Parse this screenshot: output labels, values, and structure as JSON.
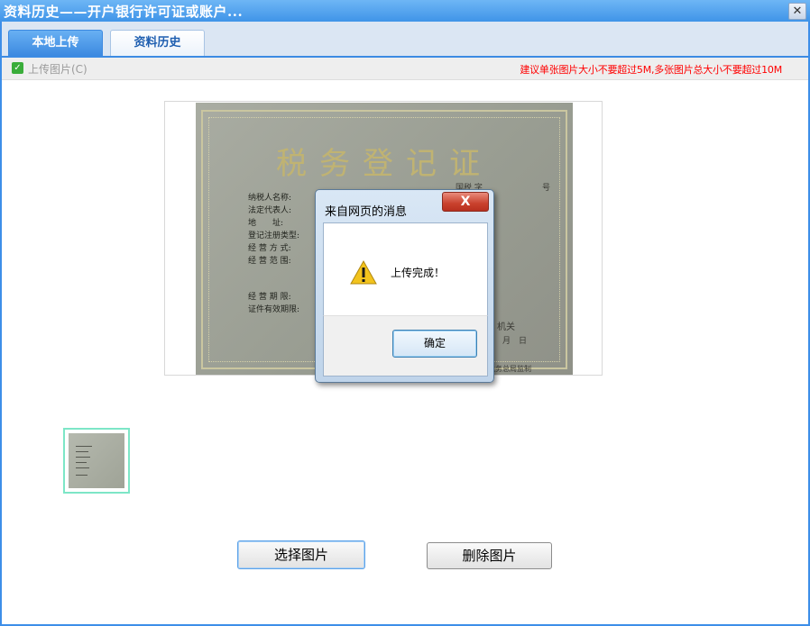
{
  "window": {
    "title": "资料历史——开户银行许可证或账户...",
    "close_glyph": "✕"
  },
  "tabs": [
    {
      "label": "本地上传",
      "active": true
    },
    {
      "label": "资料历史",
      "active": false
    }
  ],
  "toolbar": {
    "upload_label": "上传图片(C)",
    "upload_checked": true,
    "size_hint": "建议单张图片大小不要超过5M,多张图片总大小不要超过10M"
  },
  "certificate": {
    "title": "税务登记证",
    "fields": [
      "纳税人名称:",
      "法定代表人:",
      "地　　址:",
      "登记注册类型:",
      "经 营 方 式:",
      "经 营 范 围:",
      "经 营 期 限:",
      "证件有效期限:"
    ],
    "number_label": "国税 字",
    "number_suffix": "号",
    "issuer_fragment": "机关",
    "date_fragment": "月　日",
    "seal_text": "税务总局监制"
  },
  "buttons": {
    "select": "选择图片",
    "delete": "删除图片"
  },
  "dialog": {
    "title": "来自网页的消息",
    "close_glyph": "X",
    "message": "上传完成！",
    "icon": "warning-icon",
    "ok": "确定"
  },
  "colors": {
    "title_bar": "#3f94e8",
    "tab_active": "#3c89e0",
    "hint_text": "#ff0000",
    "thumb_border": "#7de6c7"
  }
}
